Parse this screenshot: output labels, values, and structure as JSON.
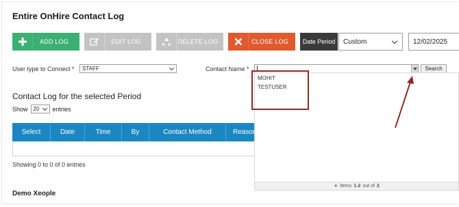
{
  "page": {
    "title": "Entire OnHire Contact Log"
  },
  "toolbar": {
    "add_label": "ADD LOG",
    "edit_label": "EDIT LOG",
    "delete_label": "DELETE LOG",
    "close_label": "CLOSE LOG",
    "add_color": "#3bb072",
    "close_color": "#e05a2e",
    "disabled_color": "#c3c3c3"
  },
  "period": {
    "label": "Date Period",
    "selected": "Custom",
    "date_value": "12/02/2025"
  },
  "filters": {
    "user_type_label": "User type to Connect *",
    "user_type_value": "STAFF",
    "contact_name_label": "Contact Name *",
    "contact_name_value": "",
    "search_label": "Search"
  },
  "contact_dropdown": {
    "options": [
      "MOHIT",
      "TESTUSER"
    ],
    "footer_prefix": "Items",
    "footer_range": "1-2",
    "footer_out_of": "out of",
    "footer_total": "2"
  },
  "log_section": {
    "title": "Contact Log for the selected Period",
    "show_label": "Show",
    "entries_value": "20",
    "entries_label": "entries",
    "columns": [
      "Select",
      "Date",
      "Time",
      "By",
      "Contact Method",
      "Reason"
    ],
    "showing_text": "Showing 0 to 0 of 0 entries"
  },
  "footer": {
    "text": "Demo Xeople"
  },
  "colors": {
    "table_header": "#1b87c2",
    "annotation": "#8b2a25",
    "period_label_bg": "#3b3b3b"
  }
}
